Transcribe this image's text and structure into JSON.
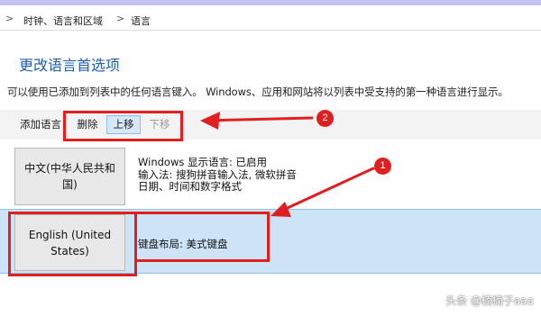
{
  "breadcrumb": {
    "items": [
      "时钟、语言和区域",
      "语言"
    ],
    "separator": ">"
  },
  "page": {
    "title": "更改语言首选项",
    "description": "可以使用已添加到列表中的任何语言键入。 Windows、应用和网站将以列表中受支持的第一种语言进行显示。"
  },
  "toolbar": {
    "add_label": "添加语言",
    "delete_label": "删除",
    "move_up_label": "上移",
    "move_down_label": "下移"
  },
  "languages": [
    {
      "name": "中文(中华人民共和国)",
      "details": [
        "Windows 显示语言: 已启用",
        "输入法: 搜狗拼音输入法, 微软拼音",
        "日期、时间和数字格式"
      ]
    },
    {
      "name": "English (United States)",
      "details": [
        "键盘布局: 美式键盘"
      ]
    }
  ],
  "annotations": {
    "badge_1": "1",
    "badge_2": "2",
    "highlight_color": "#e02020"
  },
  "watermark": {
    "text": "头条 @楠楠子aaa"
  },
  "colors": {
    "title_blue": "#1e5fae",
    "selected_row": "#cde4f7",
    "selected_border": "#8ebfe6"
  },
  "icons": [
    "chevron-right-icon",
    "arrow-left-annotation-icon"
  ]
}
